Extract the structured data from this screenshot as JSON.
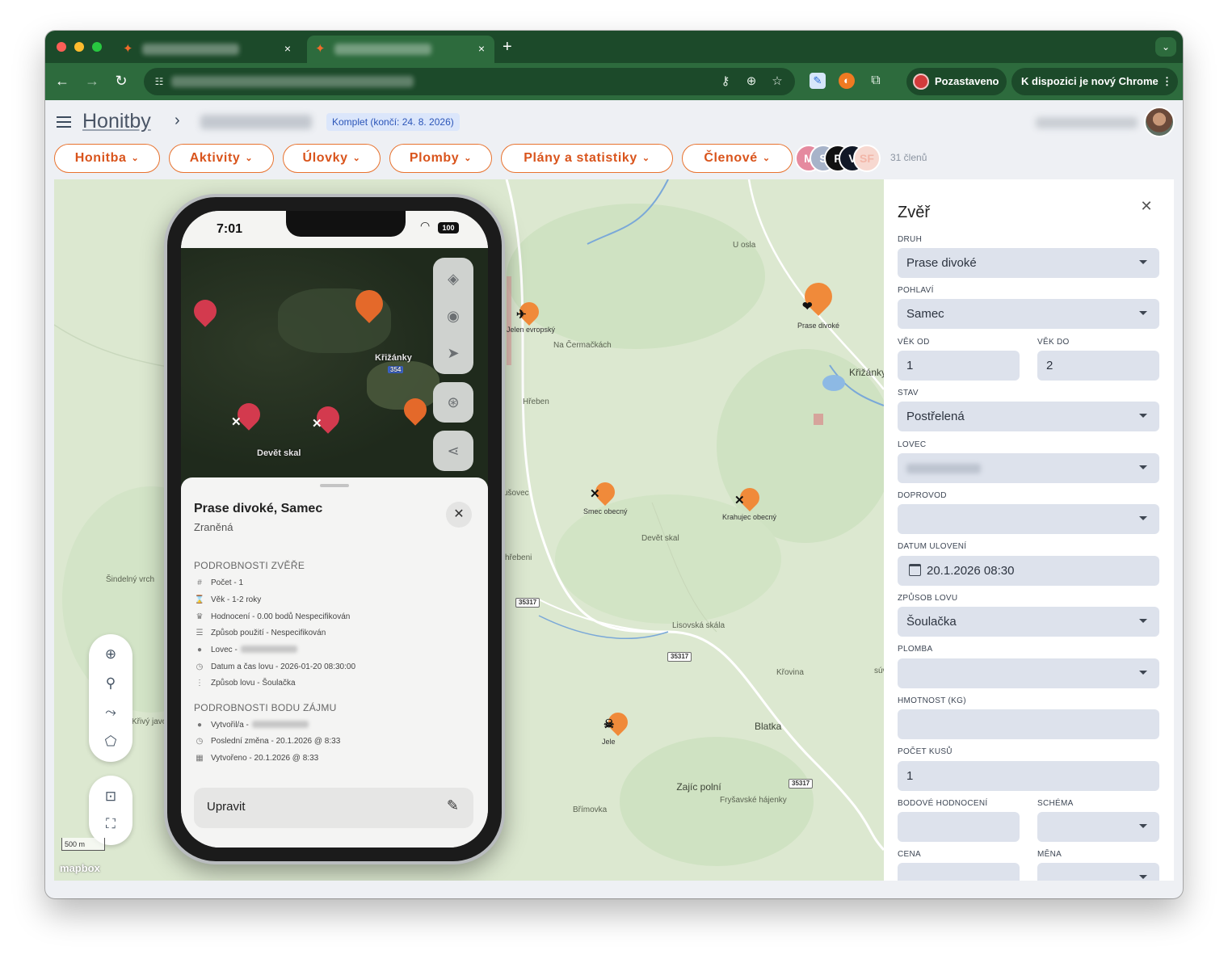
{
  "browser": {
    "tabs": [
      {
        "favicon": "hunting-logo-icon",
        "close_label": "×"
      },
      {
        "favicon": "hunting-logo-icon",
        "close_label": "×"
      }
    ],
    "new_tab_label": "+",
    "tab_menu_label": "⌄",
    "nav": {
      "back": "←",
      "forward": "→",
      "reload": "↻"
    },
    "omnibox_icons": [
      "key-icon",
      "zoom-icon",
      "star-icon"
    ],
    "profile_chip": "Pozastaveno",
    "update_chip": "K dispozici je nový Chrome",
    "colors": {
      "tabstrip": "#1c4a2a",
      "toolbar": "#2d6b3d"
    }
  },
  "header": {
    "title": "Honitby",
    "breadcrumb_separator": "›",
    "license_badge": "Komplet (končí: 24. 8. 2026)"
  },
  "menu": {
    "items": [
      "Honitba",
      "Aktivity",
      "Úlovky",
      "Plomby",
      "Plány a statistiky",
      "Členové"
    ],
    "members": [
      {
        "initial": "M",
        "color": "#e58a9f"
      },
      {
        "initial": "S",
        "color": "#a7b3c9"
      },
      {
        "initial": "P",
        "color": "#111111"
      },
      {
        "initial": "V",
        "color": "#111827"
      },
      {
        "initial": "SF",
        "color": "#f7d8d0"
      }
    ],
    "member_count": "31 členů",
    "accent": "#e8732f"
  },
  "map": {
    "labels": [
      "U osla",
      "Jelen evropský",
      "Na Čermačkách",
      "Prase divoké",
      "Křižánky",
      "Hřeben",
      "ušovec",
      "Smec obecný",
      "Krahujec obecný",
      "Devět skal",
      "hřebeni",
      "Šindelný vrch",
      "Lisovská skála",
      "Křovina",
      "Blatka",
      "Zajíc polní",
      "Fryšavské hájenky",
      "Břímovka",
      "Křivý javor",
      "súvka",
      "Jele"
    ],
    "road_badges": [
      "35317",
      "35317",
      "35317"
    ],
    "scale": "500 m",
    "attribution": "mapbox",
    "tools": [
      "add-circle-icon",
      "add-pin-icon",
      "draw-line-icon",
      "draw-polygon-icon"
    ],
    "lock_tools": [
      "unlock-icon",
      "select-area-icon"
    ]
  },
  "phone": {
    "time": "7:01",
    "battery": "100",
    "sat_labels": [
      "Křižánky",
      "354",
      "Devět skal"
    ],
    "sheet": {
      "title": "Prase divoké, Samec",
      "subtitle": "Zraněná",
      "close_label": "✕",
      "section_animal": "PODROBNOSTI ZVĚŘE",
      "animal_rows": [
        {
          "icon": "#",
          "text": "Počet - 1"
        },
        {
          "icon": "⌛",
          "text": "Věk - 1-2 roky"
        },
        {
          "icon": "♛",
          "text": "Hodnocení - 0.00 bodů Nespecifikován"
        },
        {
          "icon": "☰",
          "text": "Způsob použití - Nespecifikován"
        },
        {
          "icon": "●",
          "text": "Lovec -"
        },
        {
          "icon": "◷",
          "text": "Datum a čas lovu - 2026-01-20 08:30:00"
        },
        {
          "icon": "⋮",
          "text": "Způsob lovu - Šoulačka"
        }
      ],
      "section_poi": "PODROBNOSTI BODU ZÁJMU",
      "poi_rows": [
        {
          "icon": "●",
          "text": "Vytvořil/a -"
        },
        {
          "icon": "◷",
          "text": "Poslední změna - 20.1.2026 @ 8:33"
        },
        {
          "icon": "▦",
          "text": "Vytvořeno - 20.1.2026 @ 8:33"
        }
      ],
      "edit_label": "Upravit",
      "edit_icon": "✎"
    }
  },
  "panel": {
    "title": "Zvěř",
    "close_label": "✕",
    "fields": {
      "druh": {
        "label": "DRUH",
        "value": "Prase divoké"
      },
      "pohlavi": {
        "label": "POHLAVÍ",
        "value": "Samec"
      },
      "vek_od": {
        "label": "VĚK OD",
        "value": "1"
      },
      "vek_do": {
        "label": "VĚK DO",
        "value": "2"
      },
      "stav": {
        "label": "STAV",
        "value": "Postřelená"
      },
      "lovec": {
        "label": "LOVEC",
        "value": ""
      },
      "doprovod": {
        "label": "DOPROVOD",
        "value": ""
      },
      "datum": {
        "label": "DATUM ULOVENÍ",
        "value": "20.1.2026 08:30"
      },
      "zpusob": {
        "label": "ZPŮSOB LOVU",
        "value": "Šoulačka"
      },
      "plomba": {
        "label": "PLOMBA",
        "value": ""
      },
      "hmotnost": {
        "label": "HMOTNOST (KG)",
        "value": ""
      },
      "pocet": {
        "label": "POČET KUSŮ",
        "value": "1"
      },
      "bodove": {
        "label": "BODOVÉ HODNOCENÍ",
        "value": ""
      },
      "schema": {
        "label": "SCHÉMA",
        "value": ""
      },
      "cena": {
        "label": "CENA",
        "value": ""
      },
      "mena": {
        "label": "MĚNA",
        "value": ""
      }
    }
  }
}
